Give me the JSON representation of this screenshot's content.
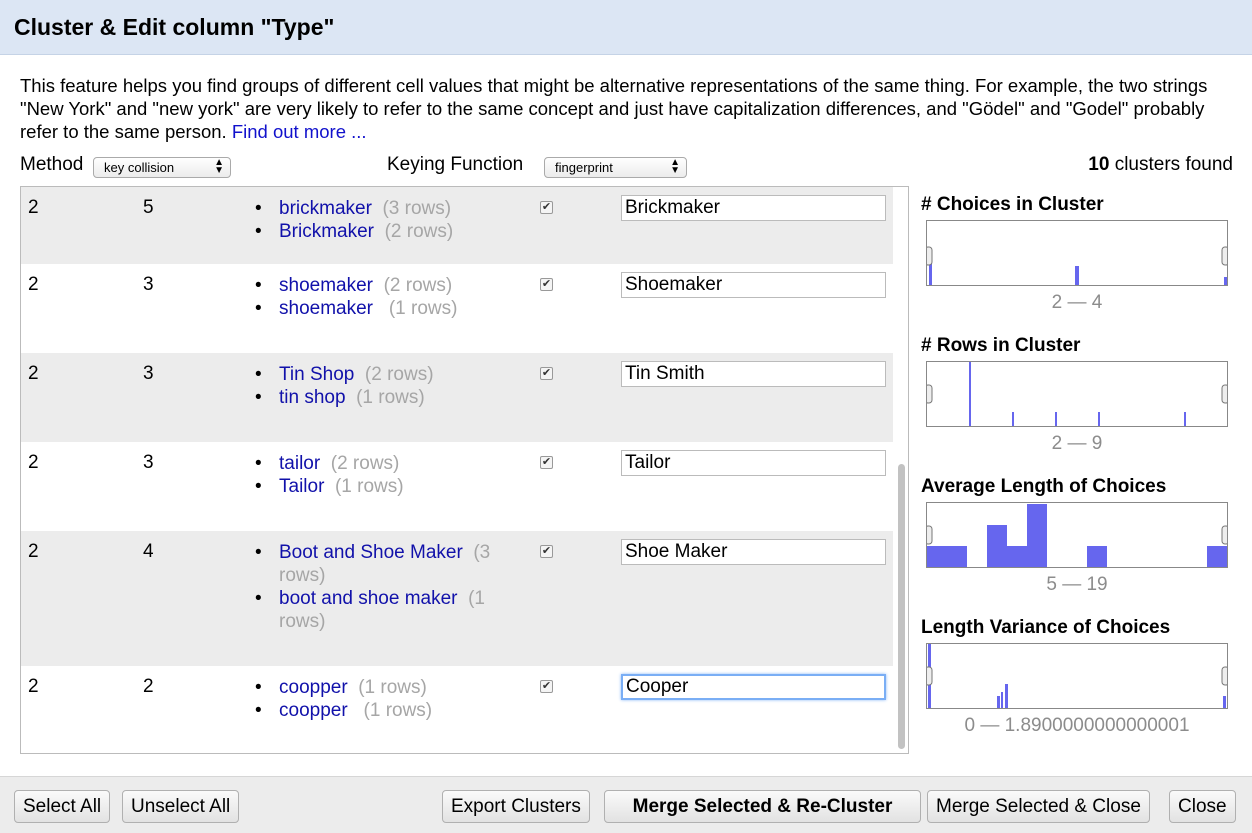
{
  "dialog": {
    "title": "Cluster & Edit column \"Type\""
  },
  "intro": {
    "text": "This feature helps you find groups of different cell values that might be alternative representations of the same thing. For example, the two strings \"New York\" and \"new york\" are very likely to refer to the same concept and just have capitalization differences, and \"Gödel\" and \"Godel\" probably refer to the same person.",
    "link": "Find out more ..."
  },
  "controls": {
    "method_label": "Method",
    "method_value": "key collision",
    "keying_label": "Keying Function",
    "keying_value": "fingerprint",
    "found_count": "10",
    "found_text": " clusters found"
  },
  "clusters": [
    {
      "size": "2",
      "rows": "5",
      "choices": [
        {
          "value": "brickmaker",
          "count": "(3 rows)"
        },
        {
          "value": "Brickmaker",
          "count": "(2 rows)"
        }
      ],
      "merge": true,
      "new_value": "Brickmaker"
    },
    {
      "size": "2",
      "rows": "3",
      "choices": [
        {
          "value": "shoemaker",
          "count": "(2 rows)"
        },
        {
          "value": "shoemaker ",
          "count": "(1 rows)"
        }
      ],
      "merge": true,
      "new_value": "Shoemaker"
    },
    {
      "size": "2",
      "rows": "3",
      "choices": [
        {
          "value": "Tin Shop",
          "count": "(2 rows)"
        },
        {
          "value": "tin shop",
          "count": "(1 rows)"
        }
      ],
      "merge": true,
      "new_value": "Tin Smith"
    },
    {
      "size": "2",
      "rows": "3",
      "choices": [
        {
          "value": "tailor",
          "count": "(2 rows)"
        },
        {
          "value": "Tailor",
          "count": "(1 rows)"
        }
      ],
      "merge": true,
      "new_value": "Tailor"
    },
    {
      "size": "2",
      "rows": "4",
      "choices": [
        {
          "value": "Boot and Shoe Maker",
          "count": "(3 rows)"
        },
        {
          "value": "boot and shoe maker",
          "count": "(1 rows)"
        }
      ],
      "merge": true,
      "new_value": "Shoe Maker"
    },
    {
      "size": "2",
      "rows": "2",
      "choices": [
        {
          "value": "coopper",
          "count": "(1 rows)"
        },
        {
          "value": "coopper ",
          "count": "(1 rows)"
        }
      ],
      "merge": true,
      "new_value": "Cooper"
    }
  ],
  "facets": [
    {
      "title": "# Choices in Cluster",
      "range": "2 — 4"
    },
    {
      "title": "# Rows in Cluster",
      "range": "2 — 9"
    },
    {
      "title": "Average Length of Choices",
      "range": "5 — 19"
    },
    {
      "title": "Length Variance of Choices",
      "range": "0 — 1.8900000000000001"
    }
  ],
  "buttons": {
    "select_all": "Select All",
    "unselect_all": "Unselect All",
    "export": "Export Clusters",
    "merge_recluster": "Merge Selected & Re-Cluster",
    "merge_close": "Merge Selected & Close",
    "close": "Close"
  },
  "colors": {
    "accent": "#11aa",
    "bar": "#6666ee",
    "title_bg": "#dce6f4"
  }
}
